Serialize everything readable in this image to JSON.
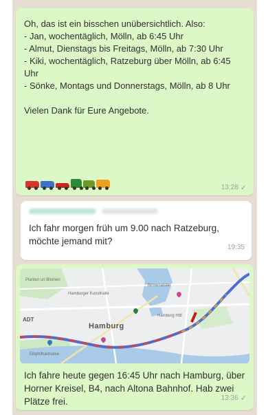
{
  "messages": [
    {
      "type": "outgoing",
      "text": "Oh, das ist ein bisschen unübersichtlich. Also:\n- Jan, wochentäglich, Mölln, ab 6:45 Uhr\n- Almut, Dienstags bis Freitags, Mölln, ab 7:30 Uhr\n- Kiki, wochentäglich, Ratzeburg über Mölln, ab 6:45 Uhr\n- Sönke, Montags und Donnerstags, Mölln, ab 8 Uhr\n\nVielen Dank für Eure Angebote.",
      "emoji": [
        "car-icon",
        "pickup-icon",
        "sports-car-icon",
        "truck-icon",
        "tractor-icon",
        "delivery-truck-icon"
      ],
      "time": "13:28",
      "status": "✓"
    },
    {
      "type": "incoming",
      "text": "Ich fahr morgen früh um 9.00 nach Ratzeburg, möchte jemand mit?",
      "time": "19:35"
    },
    {
      "type": "outgoing",
      "map": {
        "city": "Hamburg",
        "labels": [
          "Planten un Blomen",
          "Hamburger Kunsthalle",
          "Binnenalster",
          "ADT",
          "Hamburg Hbf",
          "Elbphilharmonie"
        ]
      },
      "text": "Ich fahre heute gegen 16:45 Uhr nach Hamburg, über Horner Kreisel, B4, nach Altona Bahnhof. Hab zwei Plätze frei.",
      "time": "13:36",
      "status": "✓"
    }
  ],
  "colors": {
    "outgoing_bubble": "#dcf8c6",
    "incoming_bubble": "#ffffff",
    "background": "#e6ddd3"
  }
}
